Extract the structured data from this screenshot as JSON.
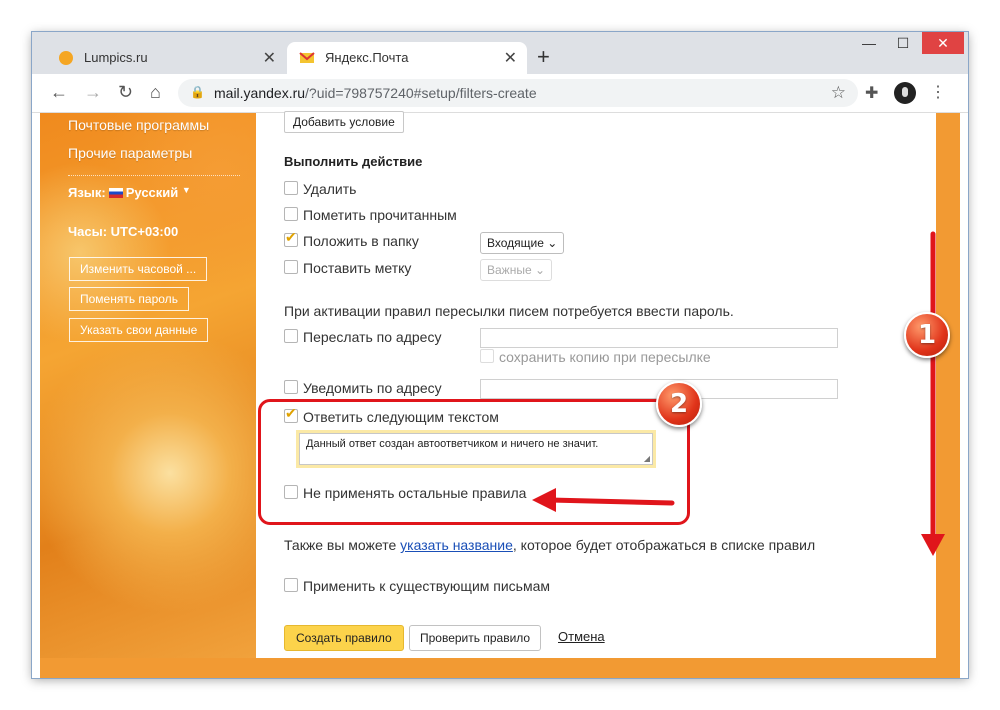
{
  "browser": {
    "tabs": [
      {
        "title": "Lumpics.ru"
      },
      {
        "title": "Яндекс.Почта"
      }
    ],
    "url_host": "mail.yandex.ru",
    "url_path": "/?uid=798757240#setup/filters-create"
  },
  "sidebar": {
    "links": [
      "Почтовые программы",
      "Прочие параметры"
    ],
    "language_label": "Язык:",
    "language_value": "Русский",
    "time_label": "Часы: UTC+03:00",
    "buttons": [
      "Изменить часовой ...",
      "Поменять пароль",
      "Указать свои данные"
    ]
  },
  "form": {
    "add_condition": "Добавить условие",
    "action_title": "Выполнить действие",
    "actions": {
      "delete": "Удалить",
      "mark_read": "Пометить прочитанным",
      "move_to_folder": "Положить в папку",
      "set_label": "Поставить метку"
    },
    "folder_select": "Входящие",
    "label_select": "Важные",
    "forward_note": "При активации правил пересылки писем потребуется ввести пароль.",
    "forward_to": "Переслать по адресу",
    "keep_copy": "сохранить копию при пересылке",
    "notify_to": "Уведомить по адресу",
    "reply_with_text": "Ответить следующим текстом",
    "reply_text": "Данный ответ создан автоответчиком и ничего не значит.",
    "dont_apply_others": "Не применять остальные правила",
    "also_prefix": "Также вы можете ",
    "also_link": "указать название",
    "also_suffix": ", которое будет отображаться в списке правил",
    "apply_existing": "Применить к существующим письмам",
    "create_button": "Создать правило",
    "check_button": "Проверить правило",
    "cancel_link": "Отмена"
  },
  "annotations": {
    "badge1": "1",
    "badge2": "2",
    "accent_color": "#e0151b"
  }
}
